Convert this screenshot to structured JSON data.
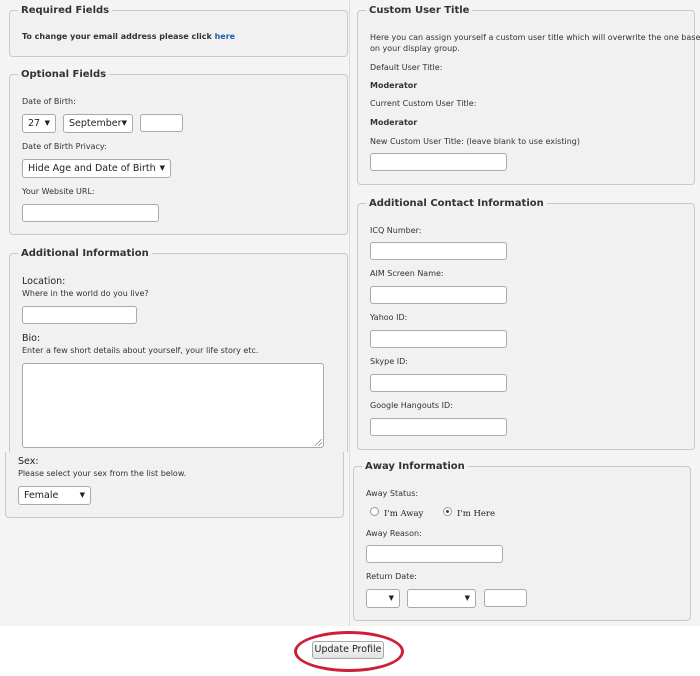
{
  "required_fields": {
    "legend": "Required Fields",
    "email_text": "To change your email address please click ",
    "email_link": "here"
  },
  "optional_fields": {
    "legend": "Optional Fields",
    "dob_label": "Date of Birth:",
    "dob_day": "27",
    "dob_month": "September",
    "dob_year": "",
    "privacy_label": "Date of Birth Privacy:",
    "privacy_value": "Hide Age and Date of Birth",
    "website_label": "Your Website URL:",
    "website_value": ""
  },
  "additional_info": {
    "legend": "Additional Information",
    "location_label": "Location:",
    "location_desc": "Where in the world do you live?",
    "location_value": "",
    "bio_label": "Bio:",
    "bio_desc": "Enter a few short details about yourself, your life story etc.",
    "bio_value": "",
    "sex_label": "Sex:",
    "sex_desc": "Please select your sex from the list below.",
    "sex_value": "Female"
  },
  "custom_title": {
    "legend": "Custom User Title",
    "desc_line1": "Here you can assign yourself a custom user title which will overwrite the one based",
    "desc_line2": "on your display group.",
    "default_label": "Default User Title:",
    "default_value": "Moderator",
    "current_label": "Current Custom User Title:",
    "current_value": "Moderator",
    "new_label": "New Custom User Title: (leave blank to use existing)",
    "new_value": ""
  },
  "contact_info": {
    "legend": "Additional Contact Information",
    "icq_label": "ICQ Number:",
    "aim_label": "AIM Screen Name:",
    "yahoo_label": "Yahoo ID:",
    "skype_label": "Skype ID:",
    "hangouts_label": "Google Hangouts ID:"
  },
  "away_info": {
    "legend": "Away Information",
    "status_label": "Away Status:",
    "option_away": "I'm Away",
    "option_here": "I'm Here",
    "selected": "I'm Here",
    "reason_label": "Away Reason:",
    "return_label": "Return Date:",
    "return_day": "",
    "return_month": "",
    "return_year": ""
  },
  "actions": {
    "update_label": "Update Profile"
  },
  "colors": {
    "link": "#1a5fa8",
    "highlight": "#cf1e3a"
  }
}
